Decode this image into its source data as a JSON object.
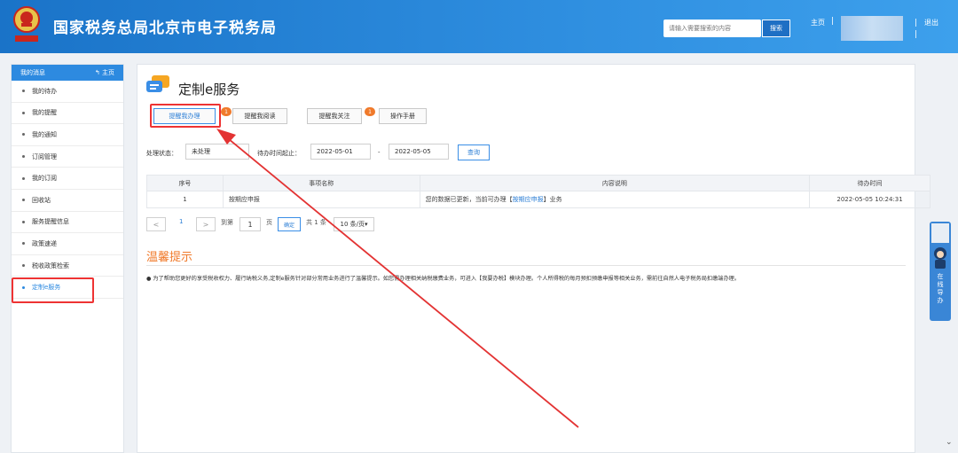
{
  "header": {
    "site_title": "国家税务总局北京市电子税务局",
    "search_placeholder": "请输入需要搜索的内容",
    "search_button": "搜索",
    "home_link": "主页",
    "separator": "|",
    "logout": "退出",
    "colors": {
      "bar": "#1a73c8",
      "accent": "#2d8ae0"
    }
  },
  "sidebar": {
    "title": "我的消息",
    "home_label": "主页",
    "items": [
      {
        "label": "我的待办"
      },
      {
        "label": "我的提醒"
      },
      {
        "label": "我的通知"
      },
      {
        "label": "订阅管理"
      },
      {
        "label": "我的订阅"
      },
      {
        "label": "回收站"
      },
      {
        "label": "服务提醒信息"
      },
      {
        "label": "政策速递"
      },
      {
        "label": "税收政策检索"
      },
      {
        "label": "定制e服务"
      }
    ],
    "active_item": "定制e服务"
  },
  "main": {
    "page_title": "定制e服务",
    "tabs": [
      {
        "label": "提醒我办理",
        "badge": "1",
        "active": true
      },
      {
        "label": "提醒我阅读"
      },
      {
        "label": "提醒我关注",
        "badge": "1"
      },
      {
        "label": "操作手册"
      }
    ],
    "filter": {
      "status_label": "处理状态：",
      "status_value": "未处理",
      "date_label": "待办时间起止：",
      "date_from": "2022-05-01",
      "date_dash": "-",
      "date_to": "2022-05-05",
      "query_button": "查询"
    },
    "table": {
      "headers": [
        "序号",
        "事项名称",
        "内容说明",
        "待办时间"
      ],
      "rows": [
        {
          "index": "1",
          "name": "按期应申报",
          "desc_prefix": "您的数据已更新，当前可办理【",
          "desc_link": "按期应申报",
          "desc_suffix": "】业务",
          "time": "2022-05-05 10:24:31"
        }
      ]
    },
    "pagination": {
      "prev": "<",
      "page": "1",
      "next": ">",
      "goto_label": "到第",
      "goto_value": "1",
      "page_suffix": "页",
      "confirm": "确定",
      "total": "共 1 条",
      "page_size": "10 条/页"
    },
    "tips": {
      "title": "温馨提示",
      "text": "● 为了帮助您更好的享受税收权力、履行纳税义务,定制e服务针对部分常用业务进行了温馨提示。如您需办理相关纳税缴费业务，可进入【我要办税】模块办理。个人所得税的每月预扣预缴申报等相关业务，需前往自然人电子税务局扣缴端办理。"
    }
  },
  "float_guide": {
    "label": "在线导办"
  },
  "annotation": {
    "color": "#e33333"
  }
}
